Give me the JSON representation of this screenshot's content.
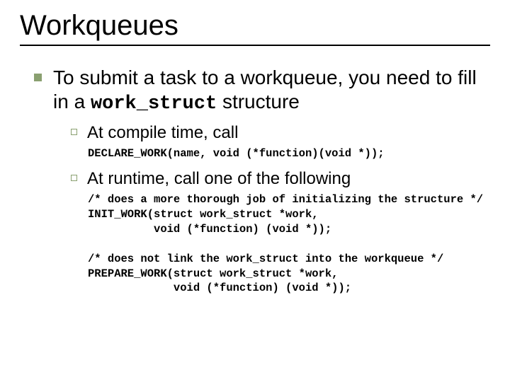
{
  "title": "Workqueues",
  "main": {
    "text_pre": "To submit a task to a workqueue, you need to fill in a ",
    "code_inline": "work_struct",
    "text_post": " structure"
  },
  "sub1": {
    "label": "At compile time, call",
    "code": "DECLARE_WORK(name, void (*function)(void *));"
  },
  "sub2": {
    "label": "At runtime, call one of the following",
    "code": "/* does a more thorough job of initializing the structure */\nINIT_WORK(struct work_struct *work,\n          void (*function) (void *));\n\n/* does not link the work_struct into the workqueue */\nPREPARE_WORK(struct work_struct *work,\n             void (*function) (void *));"
  }
}
